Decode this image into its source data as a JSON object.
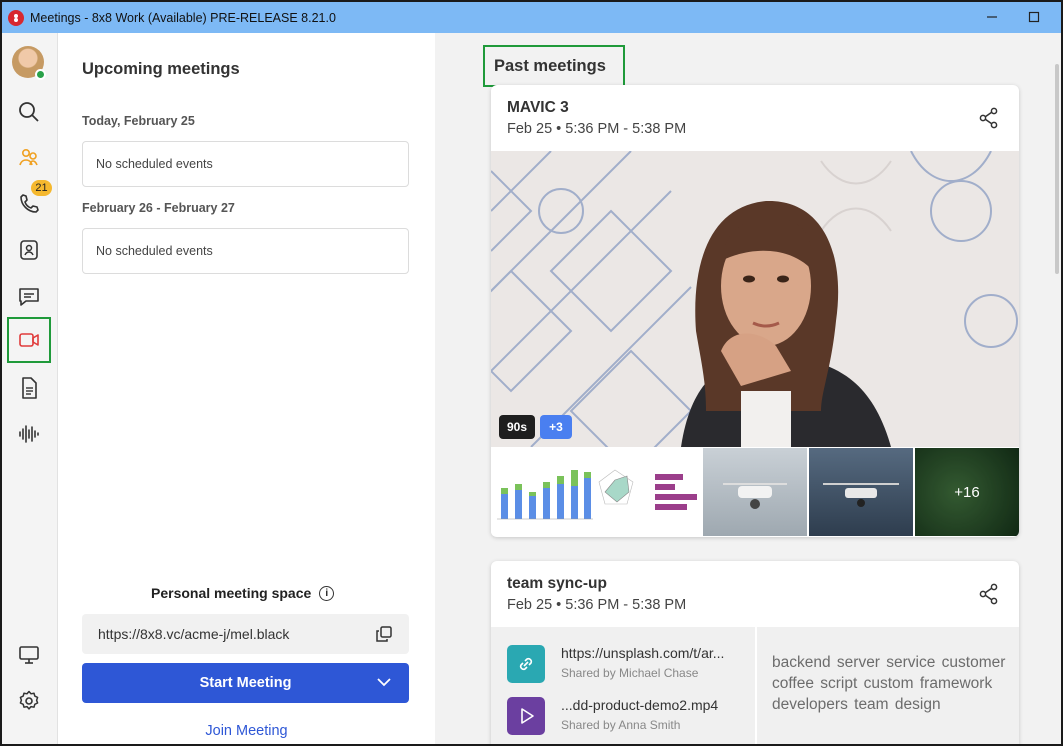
{
  "window": {
    "title": "Meetings - 8x8 Work (Available) PRE-RELEASE 8.21.0",
    "logo_icon": "8x8-logo-icon",
    "title_bar_color": "#7db9f5"
  },
  "nav": {
    "presence_color": "#2aa24a",
    "calls_badge": "21",
    "accent_color": "#1f9a3a",
    "items": [
      {
        "name": "search-icon"
      },
      {
        "name": "team-icon"
      },
      {
        "name": "phone-icon"
      },
      {
        "name": "contacts-icon"
      },
      {
        "name": "chat-icon"
      },
      {
        "name": "video-meetings-icon"
      },
      {
        "name": "document-icon"
      },
      {
        "name": "voicemail-waveform-icon"
      },
      {
        "name": "desktop-icon"
      },
      {
        "name": "settings-icon"
      }
    ]
  },
  "upcoming": {
    "title": "Upcoming meetings",
    "groups": [
      {
        "date": "Today, February 25",
        "empty_text": "No scheduled events"
      },
      {
        "date": "February 26 - February 27",
        "empty_text": "No scheduled events"
      }
    ],
    "personal_space_label": "Personal meeting space",
    "personal_space_url": "https://8x8.vc/acme-j/mel.black",
    "start_button": "Start Meeting",
    "join_link": "Join Meeting",
    "primary_color": "#2e57d6"
  },
  "past": {
    "title": "Past meetings",
    "meetings": [
      {
        "title": "MAVIC 3",
        "time": "Feb 25 • 5:36 PM - 5:38 PM",
        "duration_pill": "90s",
        "participants_pill": "+3",
        "more_thumbs": "+16"
      },
      {
        "title": "team sync-up",
        "time": "Feb 25 • 5:36 PM - 5:38 PM",
        "shared": [
          {
            "name": "https://unsplash.com/t/ar...",
            "by": "Shared by Michael Chase",
            "icon": "link-icon",
            "color": "#2aa8b2"
          },
          {
            "name": "...dd-product-demo2.mp4",
            "by": "Shared by Anna Smith",
            "icon": "video-play-icon",
            "color": "#6b3fa0"
          }
        ],
        "tags": "backend server service customer coffee script custom framework developers team design"
      }
    ]
  }
}
